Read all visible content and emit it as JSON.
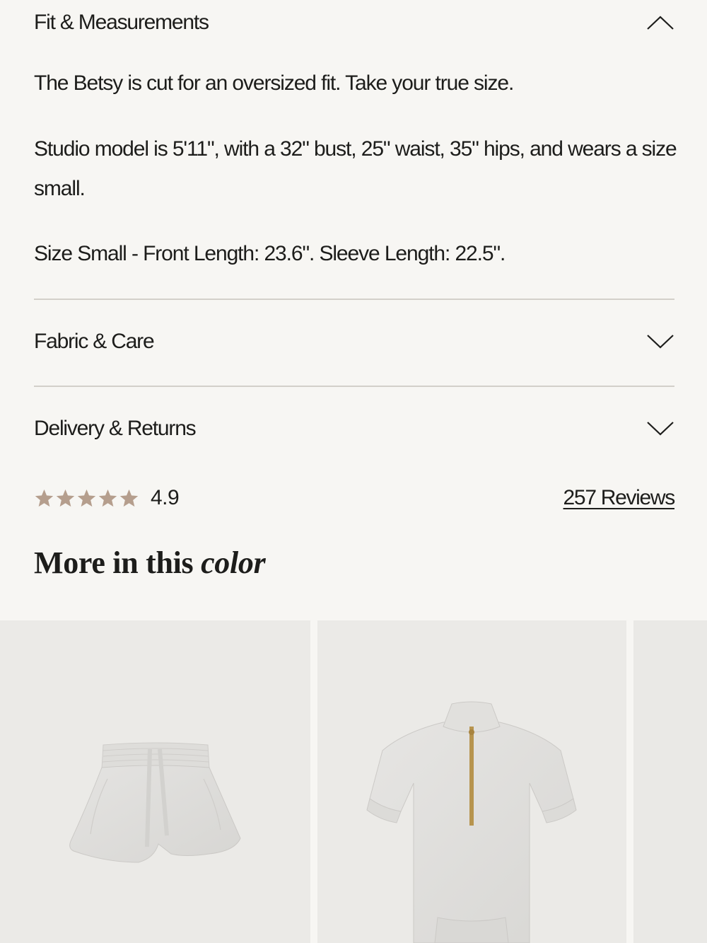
{
  "accordion": {
    "fit": {
      "title": "Fit & Measurements",
      "paragraphs": [
        "The Betsy is cut for an oversized fit. Take your true size.",
        "Studio model is 5'11\", with a 32\" bust, 25\" waist, 35\" hips, and wears a size small.",
        "Size Small - Front Length: 23.6\". Sleeve Length: 22.5\"."
      ],
      "state_icon": "chevron-up-icon"
    },
    "fabric": {
      "title": "Fabric & Care",
      "state_icon": "chevron-down-icon"
    },
    "delivery": {
      "title": "Delivery & Returns",
      "state_icon": "chevron-down-icon"
    }
  },
  "rating": {
    "stars": 5,
    "star_color": "#b59e8d",
    "value": "4.9",
    "reviews_label": "257 Reviews"
  },
  "more_section": {
    "heading_plain": "More in this ",
    "heading_italic": "color"
  },
  "products": [
    {
      "image": "heather-grey-shorts"
    },
    {
      "image": "heather-grey-half-zip-top"
    },
    {
      "image": "partial-product"
    }
  ]
}
